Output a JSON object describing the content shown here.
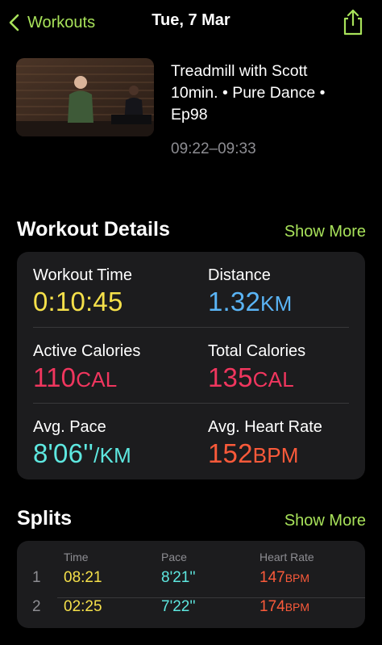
{
  "nav": {
    "back_label": "Workouts",
    "title": "Tue, 7 Mar"
  },
  "workout": {
    "title_line1": "Treadmill with Scott",
    "title_line2": "10min. • Pure Dance •",
    "title_line3": "Ep98",
    "time_range": "09:22–09:33"
  },
  "details": {
    "title": "Workout Details",
    "show_more": "Show More",
    "workout_time": {
      "label": "Workout Time",
      "value": "0:10:45",
      "color": "#f5e04a"
    },
    "distance": {
      "label": "Distance",
      "value": "1.32",
      "unit": "KM",
      "color": "#5ab4f5"
    },
    "active_calories": {
      "label": "Active Calories",
      "value": "110",
      "unit": "CAL",
      "color": "#f0365e"
    },
    "total_calories": {
      "label": "Total Calories",
      "value": "135",
      "unit": "CAL",
      "color": "#f0365e"
    },
    "avg_pace": {
      "label": "Avg. Pace",
      "value": "8'06''",
      "unit": "/KM",
      "color": "#5ee8e0"
    },
    "avg_heart_rate": {
      "label": "Avg. Heart Rate",
      "value": "152",
      "unit": "BPM",
      "color": "#fb5a3a"
    }
  },
  "splits": {
    "title": "Splits",
    "show_more": "Show More",
    "headers": {
      "time": "Time",
      "pace": "Pace",
      "heart_rate": "Heart Rate"
    },
    "rows": [
      {
        "num": "1",
        "time": "08:21",
        "pace": "8'21''",
        "hr": "147",
        "hr_unit": "BPM"
      },
      {
        "num": "2",
        "time": "02:25",
        "pace": "7'22''",
        "hr": "174",
        "hr_unit": "BPM"
      }
    ]
  },
  "icons": {
    "back": "chevron-left-icon",
    "share": "share-icon"
  },
  "colors": {
    "accent": "#a8e25a",
    "time": "#f5e04a",
    "distance": "#5ab4f5",
    "calories": "#f0365e",
    "pace": "#5ee8e0",
    "heart_rate": "#fb5a3a"
  }
}
